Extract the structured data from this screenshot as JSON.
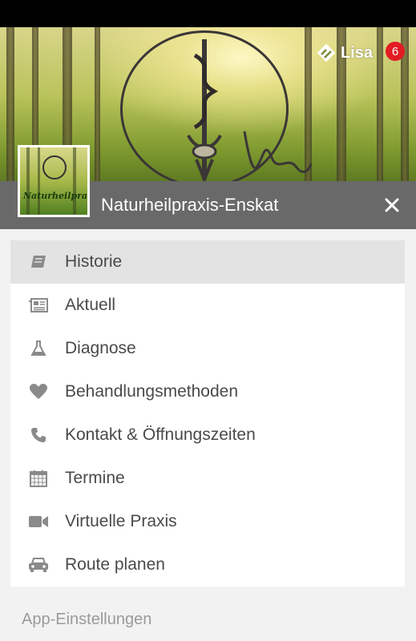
{
  "header": {
    "brand_name": "Lisa",
    "notification_count": "6",
    "title": "Naturheilpraxis-Enskat",
    "close_icon": "close-icon",
    "avatar_text": "Naturheilpraxis"
  },
  "menu": {
    "items": [
      {
        "label": "Historie",
        "icon": "book-icon",
        "active": true
      },
      {
        "label": "Aktuell",
        "icon": "newspaper-icon",
        "active": false
      },
      {
        "label": "Diagnose",
        "icon": "flask-icon",
        "active": false
      },
      {
        "label": "Behandlungsmethoden",
        "icon": "heart-icon",
        "active": false
      },
      {
        "label": "Kontakt & Öffnungszeiten",
        "icon": "phone-icon",
        "active": false
      },
      {
        "label": "Termine",
        "icon": "calendar-icon",
        "active": false
      },
      {
        "label": "Virtuelle Praxis",
        "icon": "video-camera-icon",
        "active": false
      },
      {
        "label": "Route planen",
        "icon": "car-icon",
        "active": false
      }
    ]
  },
  "footer": {
    "section_label": "App-Einstellungen"
  },
  "colors": {
    "title_bar": "#696969",
    "notification": "#e31b23",
    "icon": "#8a8a8a",
    "active_item": "#e3e3e3"
  }
}
